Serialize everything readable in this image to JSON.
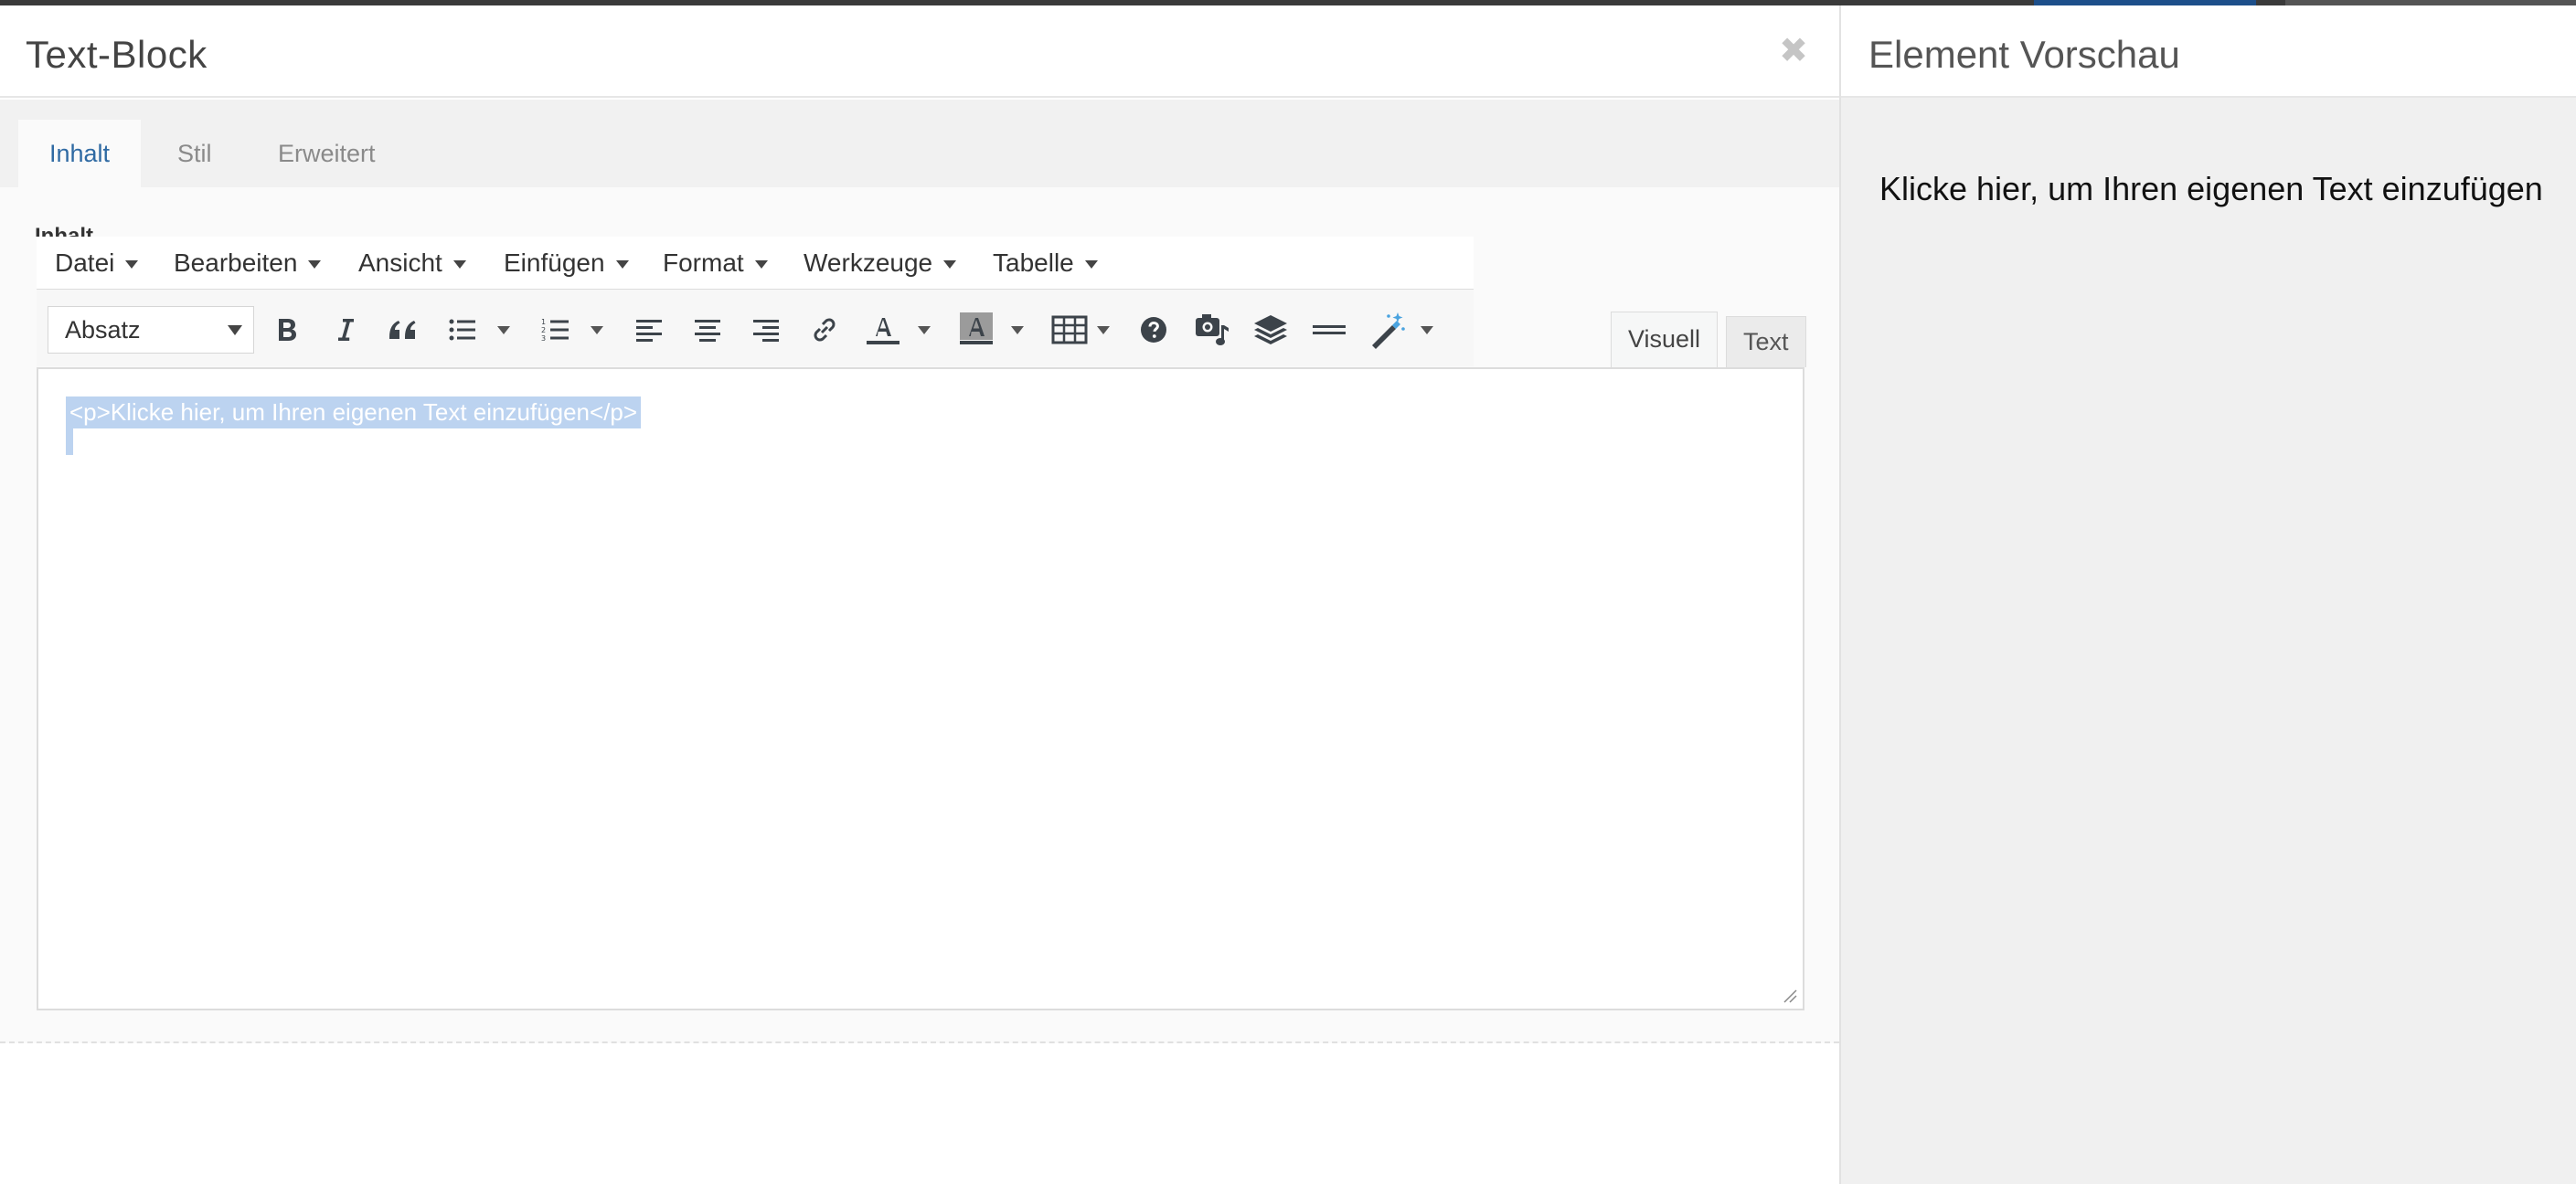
{
  "modal": {
    "title": "Text-Block",
    "close_glyph": "✖",
    "tabs": [
      {
        "label": "Inhalt",
        "active": true
      },
      {
        "label": "Stil",
        "active": false
      },
      {
        "label": "Erweitert",
        "active": false
      }
    ],
    "field_label": "Inhalt"
  },
  "editor": {
    "menu": [
      "Datei",
      "Bearbeiten",
      "Ansicht",
      "Einfügen",
      "Format",
      "Werkzeuge",
      "Tabelle"
    ],
    "format_select": "Absatz",
    "toolbar_icons": [
      "bold-icon",
      "italic-icon",
      "blockquote-icon",
      "bullet-list-icon",
      "numbered-list-icon",
      "align-left-icon",
      "align-center-icon",
      "align-right-icon",
      "link-icon",
      "text-color-icon",
      "background-color-icon",
      "table-icon",
      "help-icon",
      "media-icon",
      "layers-icon",
      "horizontal-rule-icon",
      "magic-wand-icon"
    ],
    "mode_tabs": {
      "visual": "Visuell",
      "text": "Text"
    },
    "content": "<p>Klicke hier, um Ihren eigenen Text einzufügen</p>",
    "selection_color": "#bcd3f0",
    "accent_color": "#2f6aa3"
  },
  "preview": {
    "title": "Element Vorschau",
    "text": "Klicke hier, um Ihren eigenen Text einzufügen"
  }
}
